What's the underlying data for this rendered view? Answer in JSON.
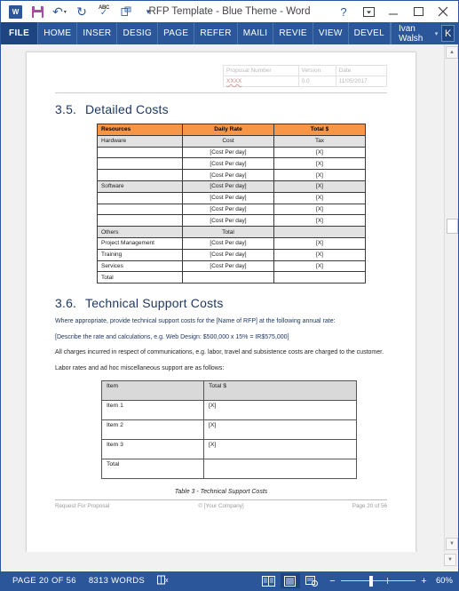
{
  "window": {
    "title": "RFP Template - Blue Theme - Word",
    "quick_access": [
      {
        "name": "word-logo-icon",
        "label": "W"
      },
      {
        "name": "save-icon",
        "label": ""
      },
      {
        "name": "undo-icon",
        "label": "↶"
      },
      {
        "name": "redo-icon",
        "label": "↻"
      },
      {
        "name": "spelling-icon",
        "label": "ABC"
      },
      {
        "name": "print-preview-icon",
        "label": ""
      },
      {
        "name": "customize-qat-icon",
        "label": "▾"
      }
    ],
    "controls": {
      "help": "?",
      "ribbon_display": "⬒",
      "minimize": "─",
      "maximize": "⬜",
      "close": "✕"
    }
  },
  "ribbon": {
    "file_tab": "FILE",
    "tabs": [
      "HOME",
      "INSER",
      "DESIG",
      "PAGE",
      "REFER",
      "MAILI",
      "REVIE",
      "VIEW",
      "DEVEL"
    ],
    "user_name": "Ivan Walsh",
    "user_caret": "▾",
    "avatar_initial": "K"
  },
  "document": {
    "header_table": {
      "columns": [
        "Proposal Number",
        "Version",
        "Date"
      ],
      "values": [
        "XXXX",
        "0.0",
        "11/05/2017"
      ]
    },
    "section_detailed": {
      "number": "3.5.",
      "title": "Detailed Costs"
    },
    "cost_table": {
      "headers": [
        "Resources",
        "Daily Rate",
        "Total $"
      ],
      "rows": [
        {
          "shaded": true,
          "cells": [
            "Hardware",
            "Cost",
            "Tax"
          ]
        },
        {
          "shaded": false,
          "cells": [
            "",
            "[Cost Per day]",
            "[X]"
          ]
        },
        {
          "shaded": false,
          "cells": [
            "",
            "[Cost Per day]",
            "[X]"
          ]
        },
        {
          "shaded": false,
          "cells": [
            "",
            "[Cost Per day]",
            "[X]"
          ]
        },
        {
          "shaded": true,
          "cells": [
            "Software",
            "[Cost Per day]",
            "[X]"
          ]
        },
        {
          "shaded": false,
          "cells": [
            "",
            "[Cost Per day]",
            "[X]"
          ]
        },
        {
          "shaded": false,
          "cells": [
            "",
            "[Cost Per day]",
            "[X]"
          ]
        },
        {
          "shaded": false,
          "cells": [
            "",
            "[Cost Per day]",
            "[X]"
          ]
        },
        {
          "shaded": true,
          "cells": [
            "Others",
            "Total",
            ""
          ]
        },
        {
          "shaded": false,
          "cells": [
            "Project Management",
            "[Cost Per day]",
            "[X]"
          ]
        },
        {
          "shaded": false,
          "cells": [
            "Training",
            "[Cost Per day]",
            "[X]"
          ]
        },
        {
          "shaded": false,
          "cells": [
            "Services",
            "[Cost Per day]",
            "[X]"
          ]
        },
        {
          "shaded": false,
          "cells": [
            "Total",
            "",
            ""
          ]
        }
      ]
    },
    "section_support": {
      "number": "3.6.",
      "title": "Technical Support Costs"
    },
    "paragraphs": {
      "p1": "Where appropriate, provide technical support costs for the [Name of RFP] at the following annual rate:",
      "p2": "[Describe the rate and calculations, e.g. Web Design: $500,000 x 15% = IR$575,000]",
      "p3": "All charges incurred in respect of communications, e.g. labor, travel and subsistence costs are charged to the customer.",
      "p4": "Labor rates and ad hoc miscellaneous support are as follows:"
    },
    "support_table": {
      "headers": [
        "Item",
        "Total $"
      ],
      "rows": [
        [
          "Item 1",
          "[X]"
        ],
        [
          "Item 2",
          "[X]"
        ],
        [
          "Item 3",
          "[X]"
        ],
        [
          "Total",
          ""
        ]
      ]
    },
    "caption": "Table 3 - Technical Support Costs",
    "footer": {
      "left": "Request For Proposal",
      "center": "© [Your Company]",
      "right": "Page 20 of 56"
    }
  },
  "status_bar": {
    "page": "PAGE 20 OF 56",
    "words": "8313 WORDS",
    "proofing_icon": "proofing-errors-icon",
    "views": [
      {
        "name": "read-mode-view",
        "active": false
      },
      {
        "name": "print-layout-view",
        "active": true
      },
      {
        "name": "web-layout-view",
        "active": false
      }
    ],
    "zoom_out": "−",
    "zoom_in": "+",
    "zoom_level": "60%"
  },
  "colors": {
    "word_blue": "#2b579a",
    "table_orange": "#f79646",
    "heading_blue": "#1f3864",
    "shade_grey": "#e2e2e2"
  }
}
